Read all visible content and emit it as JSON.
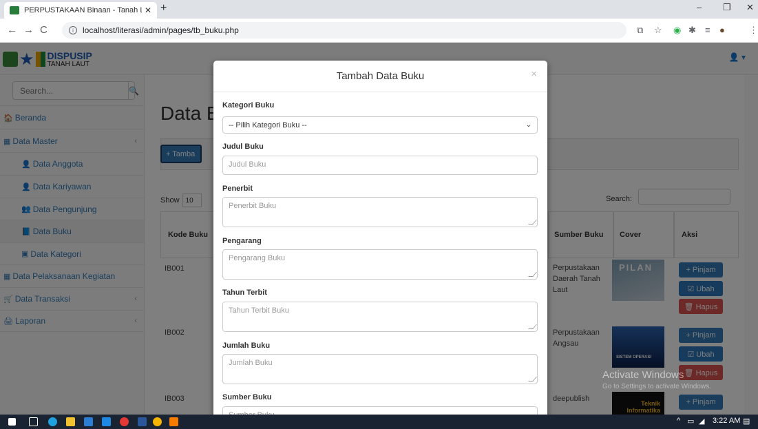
{
  "browser": {
    "tab_title": "PERPUSTAKAAN Binaan - Tanah L",
    "tab_close": "✕",
    "new_tab": "+",
    "url": "localhost/literasi/admin/pages/tb_buku.php",
    "info_icon": "i"
  },
  "window": {
    "minimize": "–",
    "maximize": "❐",
    "close": "✕"
  },
  "logo": {
    "line1": "DISPUSIP",
    "line2": "TANAH LAUT"
  },
  "sidebar": {
    "search_placeholder": "Search...",
    "items": [
      {
        "icon": "🏠",
        "label": "Beranda"
      },
      {
        "icon": "▦",
        "label": "Data Master",
        "arrow": "‹"
      },
      {
        "icon": "👤",
        "label": "Data Anggota"
      },
      {
        "icon": "👤",
        "label": "Data Kariyawan"
      },
      {
        "icon": "👥",
        "label": "Data Pengunjung"
      },
      {
        "icon": "📘",
        "label": "Data Buku"
      },
      {
        "icon": "▣",
        "label": "Data Kategori"
      },
      {
        "icon": "▦",
        "label": "Data Pelaksanaan Kegiatan"
      },
      {
        "icon": "🛒",
        "label": "Data Transaksi",
        "arrow": "‹"
      },
      {
        "icon": "🖨",
        "label": "Laporan",
        "arrow": "‹"
      }
    ]
  },
  "content": {
    "title": "Data Buku",
    "add_button": "+ Tamba",
    "show_label": "Show",
    "show_value": "10",
    "search_label": "Search:",
    "headers": {
      "kode": "Kode Buku",
      "sumber": "Sumber Buku",
      "cover": "Cover",
      "aksi": "Aksi"
    },
    "rows": [
      {
        "kode": "IB001",
        "sumber": "Perpustakaan Daerah Tanah Laut",
        "cover_text": "PILAN"
      },
      {
        "kode": "IB002",
        "sumber": "Perpustakaan Angsau",
        "cover_text": "SISTEM OPERASI"
      },
      {
        "kode": "IB003",
        "sumber": "deepublish",
        "cover_text": "Teknik Informatika"
      }
    ],
    "btn_pinjam": "+ Pinjam",
    "btn_ubah": "☑ Ubah",
    "btn_hapus": "🗑 Hapus"
  },
  "modal": {
    "title": "Tambah Data Buku",
    "close": "×",
    "fields": {
      "kategori": {
        "label": "Kategori Buku",
        "value": "-- Pilih Kategori Buku --"
      },
      "judul": {
        "label": "Judul Buku",
        "placeholder": "Judul Buku"
      },
      "penerbit": {
        "label": "Penerbit",
        "placeholder": "Penerbit Buku"
      },
      "pengarang": {
        "label": "Pengarang",
        "placeholder": "Pengarang Buku"
      },
      "tahun": {
        "label": "Tahun Terbit",
        "placeholder": "Tahun Terbit Buku"
      },
      "jumlah": {
        "label": "Jumlah Buku",
        "placeholder": "Jumlah Buku"
      },
      "sumber": {
        "label": "Sumber Buku",
        "placeholder": "Sumber Buku"
      }
    }
  },
  "watermark": {
    "line1": "Activate Windows",
    "line2": "Go to Settings to activate Windows."
  },
  "taskbar": {
    "time": "3:22 AM",
    "tray": "^"
  },
  "colors": {
    "primary": "#337ab7",
    "danger": "#d9534f",
    "taskbar": "#1a2331"
  }
}
